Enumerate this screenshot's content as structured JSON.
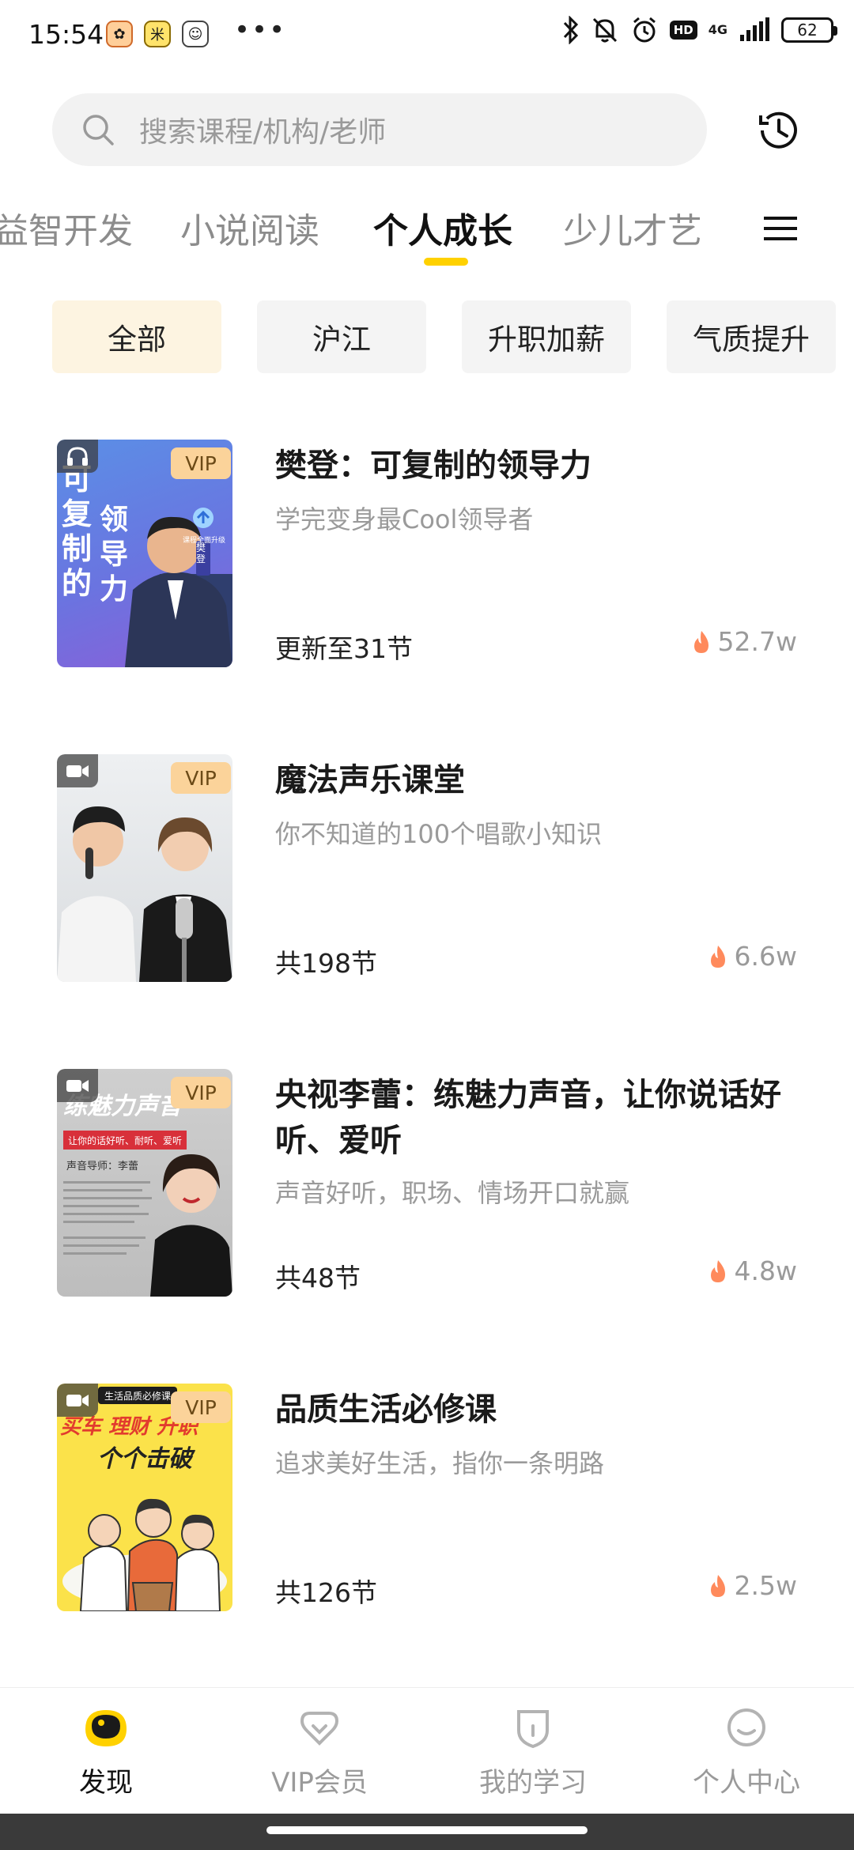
{
  "status_bar": {
    "time": "15:54",
    "app_badge_1": "✿",
    "app_badge_2": "米",
    "app_badge_3": "☺",
    "more": "•••",
    "network": "4G",
    "hd": "HD",
    "battery": "62"
  },
  "search": {
    "placeholder": "搜索课程/机构/老师"
  },
  "category_tabs": [
    {
      "label": "益智开发",
      "active": false
    },
    {
      "label": "小说阅读",
      "active": false
    },
    {
      "label": "个人成长",
      "active": true
    },
    {
      "label": "少儿才艺",
      "active": false
    }
  ],
  "chips": [
    {
      "label": "全部",
      "selected": true
    },
    {
      "label": "沪江",
      "selected": false
    },
    {
      "label": "升职加薪",
      "selected": false
    },
    {
      "label": "气质提升",
      "selected": false
    }
  ],
  "courses": [
    {
      "title": "樊登：可复制的领导力",
      "subtitle": "学完变身最Cool领导者",
      "lessons": "更新至31节",
      "heat": "52.7w",
      "badge": "VIP",
      "media_icon": "headphones-icon",
      "cover_text": [
        "可复制的",
        "领导力"
      ],
      "cover_tag": "樊登",
      "cover_note": "课程全面升级"
    },
    {
      "title": "魔法声乐课堂",
      "subtitle": "你不知道的100个唱歌小知识",
      "lessons": "共198节",
      "heat": "6.6w",
      "badge": "VIP",
      "media_icon": "video-camera-icon"
    },
    {
      "title": "央视李蕾：练魅力声音，让你说话好听、爱听",
      "subtitle": "声音好听，职场、情场开口就赢",
      "lessons": "共48节",
      "heat": "4.8w",
      "badge": "VIP",
      "media_icon": "video-camera-icon",
      "cover_text": [
        "练魅力声音"
      ],
      "cover_banner": "让你的话好听、耐听、爱听",
      "cover_teacher": "声音导师：李蕾"
    },
    {
      "title": "品质生活必修课",
      "subtitle": "追求美好生活，指你一条明路",
      "lessons": "共126节",
      "heat": "2.5w",
      "badge": "VIP",
      "media_icon": "video-camera-icon",
      "cover_text": [
        "买车 理财 升职",
        "个个击破"
      ],
      "cover_tag": "生活品质必修课"
    }
  ],
  "bottom_nav": [
    {
      "label": "发现",
      "icon": "discover-icon",
      "active": true
    },
    {
      "label": "VIP会员",
      "icon": "vip-diamond-icon",
      "active": false
    },
    {
      "label": "我的学习",
      "icon": "study-shield-icon",
      "active": false
    },
    {
      "label": "个人中心",
      "icon": "smile-face-icon",
      "active": false
    }
  ],
  "colors": {
    "accent": "#ffd100",
    "vip_bg": "#fbd39a",
    "chip_selected_bg": "#fdf4e1",
    "heat_flame": "#ff8a5c"
  }
}
